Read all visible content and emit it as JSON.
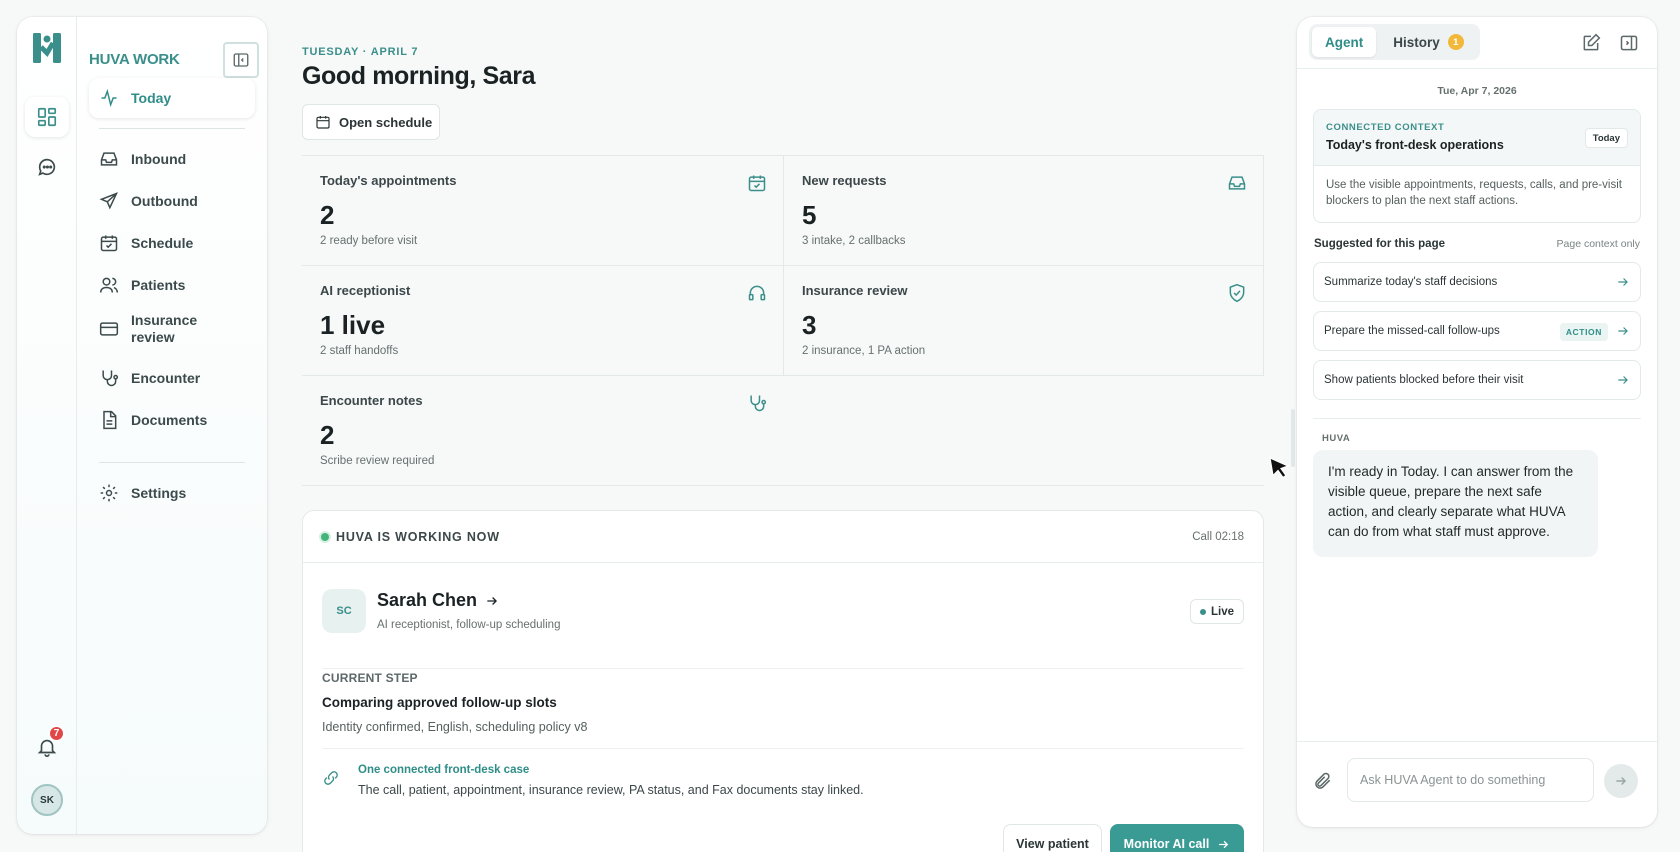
{
  "brand": {
    "name": "HUVA WORK",
    "color": "#3a8f8a"
  },
  "rail": {
    "items": [
      {
        "name": "dashboard",
        "icon": "grid-icon",
        "active": true
      },
      {
        "name": "chat",
        "icon": "chat-bubble-icon",
        "active": false
      }
    ],
    "notifications_count": "7",
    "user_initials": "SK"
  },
  "nav": {
    "items": [
      {
        "label": "Today",
        "icon": "activity-icon",
        "active": true
      },
      {
        "label": "Inbound",
        "icon": "inbox-icon"
      },
      {
        "label": "Outbound",
        "icon": "send-icon"
      },
      {
        "label": "Schedule",
        "icon": "calendar-icon"
      },
      {
        "label": "Patients",
        "icon": "users-icon"
      },
      {
        "label": "Insurance review",
        "icon": "card-icon"
      },
      {
        "label": "Encounter",
        "icon": "stethoscope-icon"
      },
      {
        "label": "Documents",
        "icon": "document-icon"
      },
      {
        "label": "Settings",
        "icon": "gear-icon"
      }
    ]
  },
  "header": {
    "date": "TUESDAY · APRIL 7",
    "greeting": "Good morning, Sara",
    "open_schedule": "Open schedule"
  },
  "stats": [
    {
      "label": "Today's appointments",
      "value": "2",
      "sub": "2 ready before visit",
      "icon": "calendar-check-icon"
    },
    {
      "label": "New requests",
      "value": "5",
      "sub": "3 intake, 2 callbacks",
      "icon": "inbox-icon"
    },
    {
      "label": "AI receptionist",
      "value": "1 live",
      "sub": "2 staff handoffs",
      "icon": "headset-icon"
    },
    {
      "label": "Insurance review",
      "value": "3",
      "sub": "2 insurance, 1 PA action",
      "icon": "shield-check-icon"
    },
    {
      "label": "Encounter notes",
      "value": "2",
      "sub": "Scribe review required",
      "icon": "stethoscope-icon"
    }
  ],
  "working": {
    "title": "HUVA IS WORKING NOW",
    "call_time": "Call 02:18",
    "patient": {
      "initials": "SC",
      "name": "Sarah Chen",
      "sub": "AI receptionist, follow-up scheduling",
      "status": "Live"
    },
    "step_label": "CURRENT STEP",
    "step_title": "Comparing approved follow-up slots",
    "step_sub": "Identity confirmed, English, scheduling policy v8",
    "case_title": "One connected front-desk case",
    "case_sub": "The call, patient, appointment, insurance review, PA status, and Fax documents stay linked.",
    "view_patient": "View patient",
    "monitor": "Monitor AI call",
    "accent": "#3a9a94"
  },
  "agent": {
    "tabs": [
      {
        "label": "Agent",
        "active": true
      },
      {
        "label": "History",
        "badge": "1"
      }
    ],
    "date": "Tue, Apr 7, 2026",
    "context": {
      "kicker": "CONNECTED CONTEXT",
      "title": "Today's front-desk operations",
      "tag": "Today",
      "body": "Use the visible appointments, requests, calls, and pre-visit blockers to plan the next staff actions."
    },
    "suggested_title": "Suggested for this page",
    "suggested_note": "Page context only",
    "suggestions": [
      {
        "label": "Summarize today's staff decisions"
      },
      {
        "label": "Prepare the missed-call follow-ups",
        "badge": "ACTION"
      },
      {
        "label": "Show patients blocked before their visit"
      }
    ],
    "huva_label": "HUVA",
    "message": "I'm ready in Today. I can answer from the visible queue, prepare the next safe action, and clearly separate what HUVA can do from what staff must approve.",
    "input_placeholder": "Ask HUVA Agent to do something"
  }
}
